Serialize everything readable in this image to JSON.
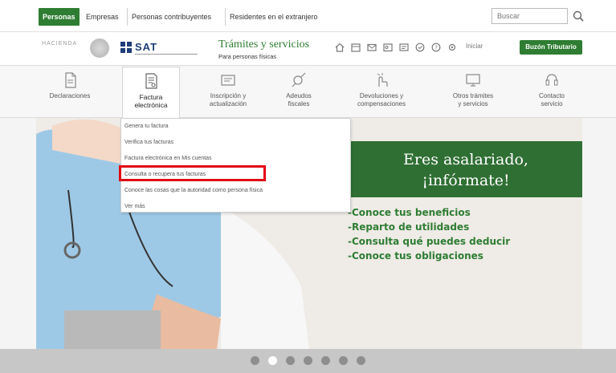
{
  "topbar": {
    "tabs": [
      "Personas",
      "Empresas",
      "Personas contribuyentes",
      "Residentes en el extranjero"
    ],
    "search": {
      "placeholder": "Buscar"
    }
  },
  "header": {
    "hacienda_logo": "HACIENDA",
    "brand": "SAT",
    "title": "Trámites y servicios",
    "subtitle": "Para personas físicas",
    "user_link": "Iniciar",
    "buzon_button": "Buzón Tributario",
    "icons": [
      "home-icon",
      "calendar-icon",
      "mail-icon",
      "contact-icon",
      "phone-icon",
      "chat-icon",
      "help-icon"
    ]
  },
  "nav": {
    "items": [
      {
        "line1": "Declaraciones",
        "line2": "",
        "icon": "document-icon"
      },
      {
        "line1": "Factura",
        "line2": "electrónica",
        "icon": "invoice-icon",
        "active": true
      },
      {
        "line1": "Inscripción y",
        "line2": "actualización",
        "icon": "registration-icon"
      },
      {
        "line1": "Adeudos",
        "line2": "fiscales",
        "icon": "debt-icon"
      },
      {
        "line1": "Devoluciones y",
        "line2": "compensaciones",
        "icon": "refund-icon"
      },
      {
        "line1": "Otros trámites",
        "line2": "y servicios",
        "icon": "services-icon"
      },
      {
        "line1": "Contacto",
        "line2": "servicio",
        "icon": "contact-icon"
      }
    ]
  },
  "dropdown": {
    "items": [
      "Genera tu factura",
      "Verifica tus facturas",
      "Factura electrónica en Mis cuentas",
      "Consulta o recupera tus facturas",
      "Conoce las cosas que la autoridad como persona física",
      "Ver más"
    ],
    "highlighted_index": 3
  },
  "hero": {
    "headline_1": "Eres asalariado,",
    "headline_2": "¡infórmate!",
    "bullets": [
      "-Conoce tus beneficios",
      "-Reparto de utilidades",
      "-Consulta qué puedes deducir",
      "-Conoce tus obligaciones"
    ]
  },
  "carousel": {
    "total": 7,
    "active_index": 1
  },
  "colors": {
    "accent_green": "#2e7d32",
    "promo_green": "#2f6f33",
    "sat_blue": "#1f3d7a",
    "highlight_red": "#e30613"
  }
}
